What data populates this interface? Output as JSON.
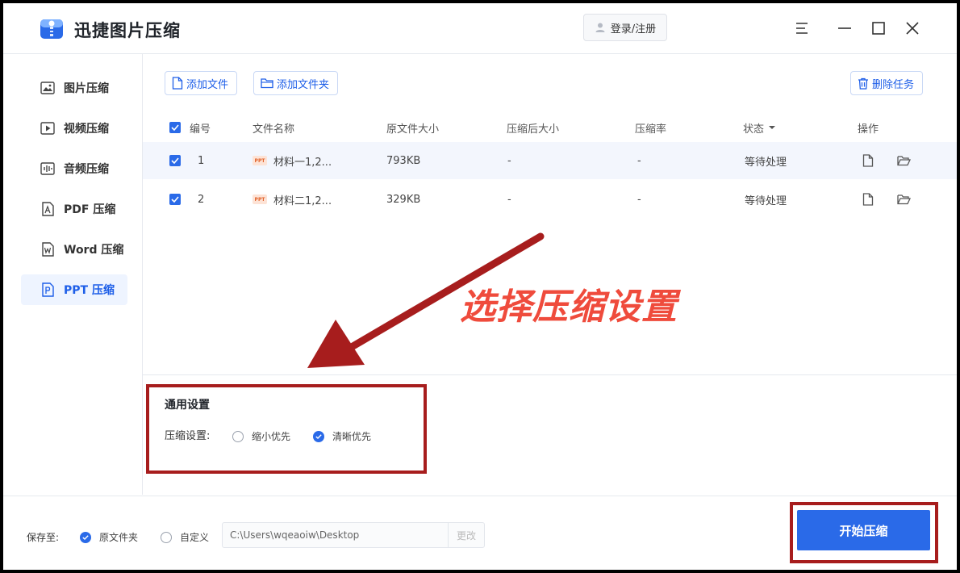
{
  "app": {
    "title": "迅捷图片压缩"
  },
  "header": {
    "login_label": "登录/注册"
  },
  "sidebar": {
    "items": [
      {
        "label": "图片压缩",
        "icon": "image-icon"
      },
      {
        "label": "视频压缩",
        "icon": "video-icon"
      },
      {
        "label": "音频压缩",
        "icon": "audio-icon"
      },
      {
        "label": "PDF 压缩",
        "icon": "pdf-icon"
      },
      {
        "label": "Word 压缩",
        "icon": "word-icon"
      },
      {
        "label": "PPT 压缩",
        "icon": "ppt-icon"
      }
    ],
    "active_index": 5
  },
  "toolbar": {
    "add_file": "添加文件",
    "add_folder": "添加文件夹",
    "delete_task": "删除任务"
  },
  "table": {
    "headers": {
      "number": "编号",
      "name": "文件名称",
      "original_size": "原文件大小",
      "compressed_size": "压缩后大小",
      "ratio": "压缩率",
      "status": "状态",
      "actions": "操作"
    },
    "rows": [
      {
        "number": "1",
        "name": "材料一1,2...",
        "original_size": "793KB",
        "compressed_size": "-",
        "ratio": "-",
        "status": "等待处理",
        "icon_label": "PPT"
      },
      {
        "number": "2",
        "name": "材料二1,2...",
        "original_size": "329KB",
        "compressed_size": "-",
        "ratio": "-",
        "status": "等待处理",
        "icon_label": "PPT"
      }
    ]
  },
  "settings": {
    "title": "通用设置",
    "compress_label": "压缩设置:",
    "options": [
      {
        "label": "缩小优先",
        "selected": false
      },
      {
        "label": "清晰优先",
        "selected": true
      }
    ]
  },
  "footer": {
    "save_label": "保存至:",
    "options": [
      {
        "label": "原文件夹",
        "selected": true
      },
      {
        "label": "自定义",
        "selected": false
      }
    ],
    "path": "C:\\Users\\wqeaoiw\\Desktop",
    "change_label": "更改",
    "start_label": "开始压缩"
  },
  "annotation": {
    "text": "选择压缩设置"
  },
  "colors": {
    "accent": "#2a6ae8",
    "annotation_red": "#ef4b3c",
    "frame_red": "#a71d1d"
  }
}
